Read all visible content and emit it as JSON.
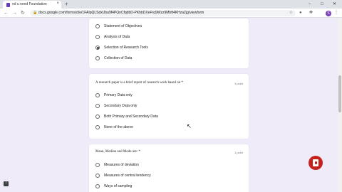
{
  "browser": {
    "tab_title": "ed u need Foundation",
    "new_tab": "+",
    "url": "docs.google.com/forms/d/e/1FAIpQLSdxUba9f4PQnCfqdbD-PKhbDXeFrq9Wzz9Mbft4KHzaZjg/viewform",
    "window_controls": [
      "–",
      "□",
      "✕"
    ]
  },
  "card_top": {
    "options": [
      {
        "label": "Statement of Objectives",
        "selected": false
      },
      {
        "label": "Analysis of Data",
        "selected": false
      },
      {
        "label": "Selection of Research Tools",
        "selected": true
      },
      {
        "label": "Collection of Data",
        "selected": false
      }
    ]
  },
  "question_2": {
    "title": "A research paper is a brief report of research work based on *",
    "points": "1 point",
    "options": [
      {
        "label": "Primary Data only",
        "selected": false
      },
      {
        "label": "Secondary Data only",
        "selected": false
      },
      {
        "label": "Both Primary and Secondary Data",
        "selected": false
      },
      {
        "label": "None of the above",
        "selected": false
      }
    ]
  },
  "question_3": {
    "title": "Mean, Median and Mode are: *",
    "points": "1 point",
    "options": [
      {
        "label": "Measures of deviation",
        "selected": false
      },
      {
        "label": "Measures of central tendency",
        "selected": false
      },
      {
        "label": "Ways of sampling",
        "selected": false
      }
    ]
  },
  "colors": {
    "page_bg": "#f0ebf8",
    "card_bg": "#ffffff",
    "fab": "#c5221f"
  },
  "icons": {
    "fab": "screen-record-icon",
    "help": "help-icon"
  }
}
